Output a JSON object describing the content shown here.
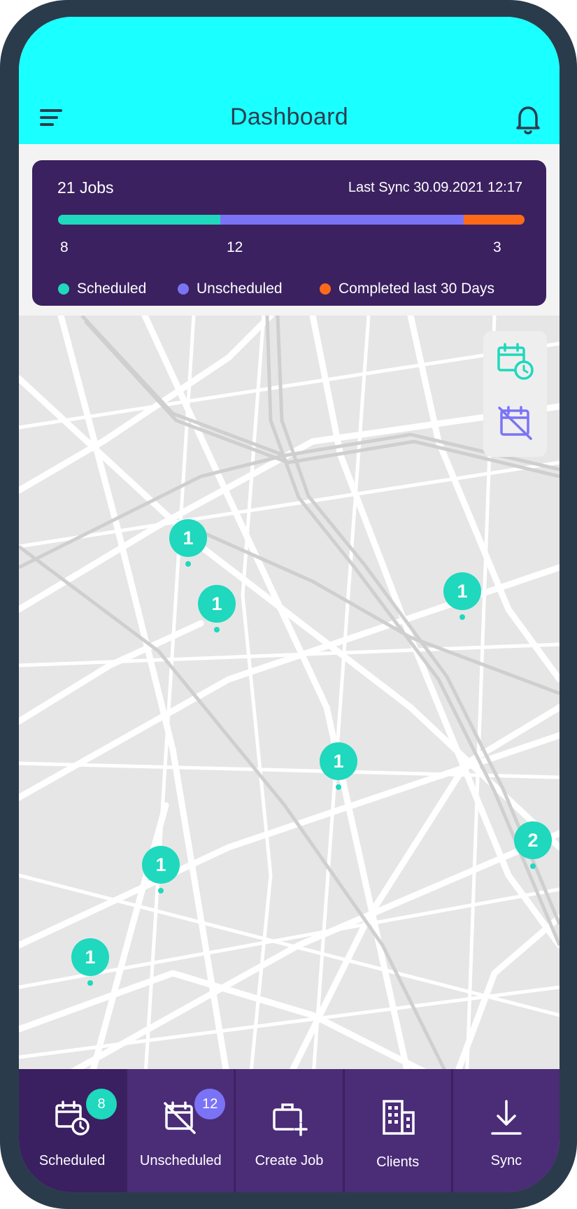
{
  "header": {
    "title": "Dashboard",
    "menu_icon": "menu-icon",
    "notification_icon": "bell-icon",
    "background_color": "#1affff"
  },
  "summary": {
    "jobs_total": "21 Jobs",
    "last_sync": "Last Sync 30.09.2021  12:17",
    "counts": {
      "scheduled": 8,
      "unscheduled": 12,
      "completed": 3
    },
    "count_labels": {
      "scheduled": "8",
      "unscheduled": "12",
      "completed": "3"
    },
    "legend": {
      "scheduled": "Scheduled",
      "unscheduled": "Unscheduled",
      "completed": "Completed last 30 Days"
    },
    "colors": {
      "scheduled": "#1fd8bd",
      "unscheduled": "#7b73f5",
      "completed": "#ff6a1a",
      "card_background": "#3b2160"
    }
  },
  "map": {
    "filter_buttons": [
      {
        "icon": "calendar-clock-icon"
      },
      {
        "icon": "calendar-off-icon"
      }
    ],
    "clusters": [
      {
        "count": "1"
      },
      {
        "count": "1"
      },
      {
        "count": "1"
      },
      {
        "count": "1"
      },
      {
        "count": "2"
      },
      {
        "count": "1"
      },
      {
        "count": "1"
      }
    ],
    "cluster_color": "#1fd8bd"
  },
  "nav": {
    "items": [
      {
        "label": "Scheduled",
        "icon": "calendar-clock-icon",
        "badge": "8",
        "badge_color": "#1fd8bd",
        "active": true
      },
      {
        "label": "Unscheduled",
        "icon": "calendar-off-icon",
        "badge": "12",
        "badge_color": "#7b73f5",
        "active": false
      },
      {
        "label": "Create Job",
        "icon": "briefcase-plus-icon",
        "active": false
      },
      {
        "label": "Clients",
        "icon": "building-icon",
        "active": false
      },
      {
        "label": "Sync",
        "icon": "download-icon",
        "active": false
      }
    ],
    "background_color": "#3b2160"
  }
}
